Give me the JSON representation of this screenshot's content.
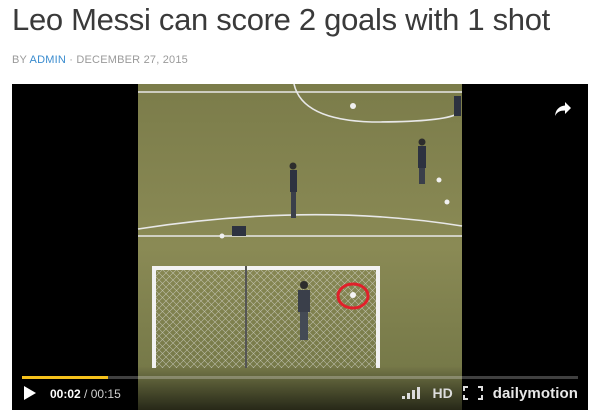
{
  "article": {
    "title": "Leo Messi can score 2 goals with 1 shot",
    "meta_by": "BY ",
    "author": "ADMIN",
    "separator": " · ",
    "date": "DECEMBER 27, 2015"
  },
  "player": {
    "current_time": "00:02",
    "time_separator": " / ",
    "duration": "00:15",
    "progress": 0.155,
    "hd_label": "HD",
    "brand": "dailymotion",
    "progress_color": "#f6c21c",
    "highlight_color": "#e0202a",
    "icons": {
      "share": "share-arrow-icon",
      "play": "play-icon",
      "quality": "signal-bars-icon",
      "fullscreen": "fullscreen-icon"
    }
  }
}
